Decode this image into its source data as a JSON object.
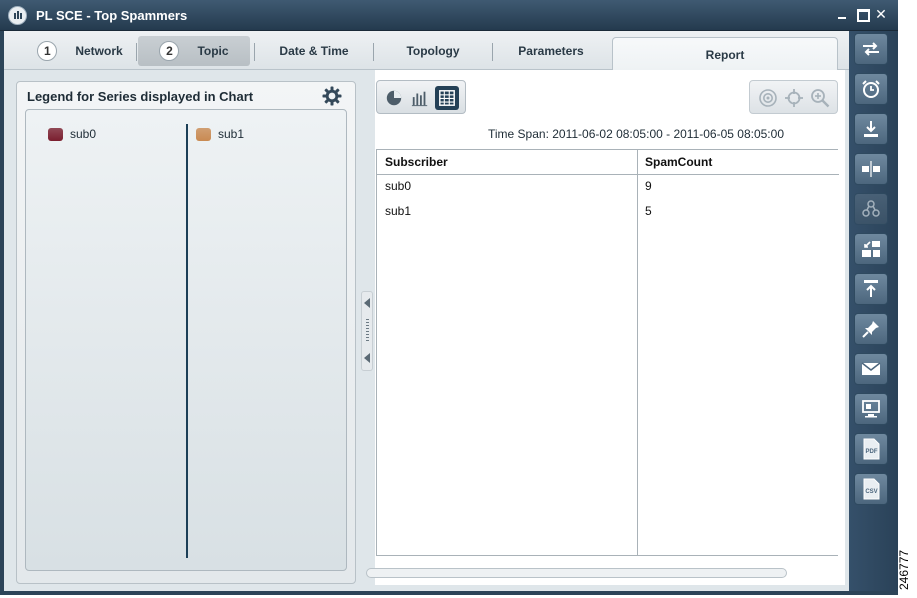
{
  "window": {
    "title": "PL SCE - Top Spammers",
    "controls": [
      "minimize",
      "maximize",
      "close"
    ],
    "close_glyph": "✕"
  },
  "tabs": [
    {
      "number": "1",
      "label": "Network"
    },
    {
      "number": "2",
      "label": "Topic",
      "highlighted": true
    },
    {
      "label": "Date & Time"
    },
    {
      "label": "Topology"
    },
    {
      "label": "Parameters"
    },
    {
      "label": "Report",
      "selected": true
    }
  ],
  "legend": {
    "title": "Legend for Series displayed in Chart",
    "settings_icon": "gear-icon",
    "items": [
      {
        "label": "sub0",
        "color": "#7a1e2e"
      },
      {
        "label": "sub1",
        "color": "#c98a52"
      }
    ]
  },
  "view_toggle": {
    "options": [
      "pie-chart-icon",
      "bar-chart-icon",
      "table-icon"
    ],
    "selected": "table-icon"
  },
  "zoom_tools": [
    "target-icon",
    "crosshair-icon",
    "zoom-in-icon"
  ],
  "report": {
    "timespan": "Time Span: 2011-06-02 08:05:00 - 2011-06-05 08:05:00",
    "table": {
      "columns": [
        "Subscriber",
        "SpamCount"
      ],
      "rows": [
        [
          "sub0",
          "9"
        ],
        [
          "sub1",
          "5"
        ]
      ]
    }
  },
  "toolbar": {
    "buttons": [
      "swap-icon",
      "alarm-clock-icon",
      "download-icon",
      "split-icon",
      "hierarchy-icon",
      "resize-icon",
      "upload-icon",
      "pin-icon",
      "mail-icon",
      "monitor-icon",
      "pdf-icon",
      "csv-icon"
    ],
    "disabled": [
      "hierarchy-icon"
    ],
    "pdf_label": "PDF",
    "csv_label": "CSV"
  },
  "watermark": "246777",
  "colors": {
    "titlebar": "#2c4458",
    "toolbar": "#35506a",
    "legend_divider": "#1c3f57"
  }
}
